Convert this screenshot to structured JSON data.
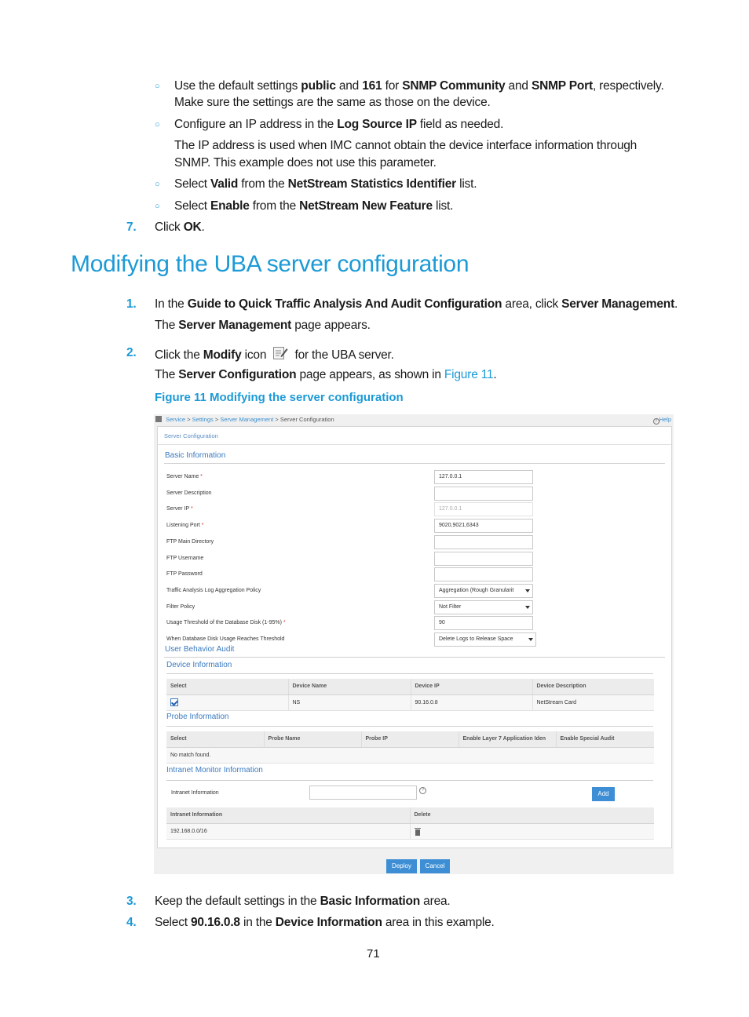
{
  "document": {
    "bullets_top": [
      {
        "parts": [
          [
            "Use the default settings ",
            false
          ],
          [
            "public",
            true
          ],
          [
            " and ",
            false
          ],
          [
            "161",
            true
          ],
          [
            " for ",
            false
          ],
          [
            "SNMP Community",
            true
          ],
          [
            " and ",
            false
          ],
          [
            "SNMP Port",
            true
          ],
          [
            ", respectively.",
            false
          ]
        ],
        "cont": "Make sure the settings are the same as those on the device."
      },
      {
        "parts": [
          [
            "Configure an IP address in the ",
            false
          ],
          [
            "Log Source IP",
            true
          ],
          [
            " field as needed.",
            false
          ]
        ]
      },
      {
        "para1": "The IP address is used when IMC cannot obtain the device interface information through",
        "para2": "SNMP. This example does not use this parameter."
      },
      {
        "parts": [
          [
            "Select ",
            false
          ],
          [
            "Valid",
            true
          ],
          [
            " from the ",
            false
          ],
          [
            "NetStream Statistics Identifier",
            true
          ],
          [
            " list.",
            false
          ]
        ]
      },
      {
        "parts": [
          [
            "Select ",
            false
          ],
          [
            "Enable",
            true
          ],
          [
            " from the ",
            false
          ],
          [
            "NetStream New Feature",
            true
          ],
          [
            " list.",
            false
          ]
        ]
      }
    ],
    "step7": {
      "num": "7.",
      "pre": "Click ",
      "bold": "OK",
      "post": "."
    },
    "heading": "Modifying the UBA server configuration",
    "step1": {
      "num": "1.",
      "a": "In the ",
      "b": "Guide to Quick Traffic Analysis And Audit Configuration",
      "c": " area, click ",
      "d": "Server Management",
      "e": ".",
      "sub_a": "The ",
      "sub_b": "Server Management",
      "sub_c": " page appears."
    },
    "step2": {
      "num": "2.",
      "a": "Click the ",
      "b": "Modify",
      "c": " icon",
      "d": " for the UBA server.",
      "sub_a": "The ",
      "sub_b": "Server Configuration",
      "sub_c": " page appears, as shown in ",
      "sub_link": "Figure 11",
      "sub_d": "."
    },
    "figure_caption": "Figure 11 Modifying the server configuration",
    "step3": {
      "num": "3.",
      "a": "Keep the default settings in the ",
      "b": "Basic Information",
      "c": " area."
    },
    "step4": {
      "num": "4.",
      "a": "Select ",
      "b": "90.16.0.8",
      "c": " in the ",
      "d": "Device Information",
      "e": " area in this example."
    },
    "page_number": "71"
  },
  "figure": {
    "breadcrumb": [
      "Service",
      "Settings",
      "Server Management",
      "Server Configuration"
    ],
    "help": "Help",
    "panel_title": "Server Configuration",
    "basic_info_title": "Basic Information",
    "fields": [
      {
        "label": "Server Name",
        "required": true,
        "value": "127.0.0.1",
        "type": "text"
      },
      {
        "label": "Server Description",
        "required": false,
        "value": "",
        "type": "text"
      },
      {
        "label": "Server IP",
        "required": true,
        "value": "127.0.0.1",
        "type": "disabled"
      },
      {
        "label": "Listening Port",
        "required": true,
        "value": "9020,9021,6343",
        "type": "text"
      },
      {
        "label": "FTP Main Directory",
        "required": false,
        "value": "",
        "type": "text"
      },
      {
        "label": "FTP Username",
        "required": false,
        "value": "",
        "type": "text"
      },
      {
        "label": "FTP Password",
        "required": false,
        "value": "",
        "type": "text"
      },
      {
        "label": "Traffic Analysis Log Aggregation Policy",
        "required": false,
        "value": "Aggregation (Rough Granularit",
        "type": "select"
      },
      {
        "label": "Filter Policy",
        "required": false,
        "value": "Not Filter",
        "type": "select"
      },
      {
        "label": "Usage Threshold of the Database Disk (1-95%)",
        "required": true,
        "value": "90",
        "type": "text"
      },
      {
        "label": "When Database Disk Usage Reaches Threshold",
        "required": false,
        "value": "Delete Logs to Release Space",
        "type": "select"
      }
    ],
    "uba_title": "User Behavior Audit",
    "device_info": {
      "title": "Device Information",
      "columns": [
        "Select",
        "Device Name",
        "Device IP",
        "Device Description"
      ],
      "rows": [
        {
          "checked": true,
          "name": "NS",
          "ip": "90.16.0.8",
          "description": "NetStream Card"
        }
      ]
    },
    "probe_info": {
      "title": "Probe Information",
      "columns": [
        "Select",
        "Probe Name",
        "Probe IP",
        "Enable Layer 7 Application Iden",
        "Enable Special Audit"
      ],
      "empty": "No match found."
    },
    "intranet": {
      "title": "Intranet Monitor Information",
      "label": "Intranet Information",
      "input_value": "",
      "add_label": "Add",
      "columns": [
        "Intranet Information",
        "Delete"
      ],
      "rows": [
        {
          "value": "192.168.0.0/16"
        }
      ]
    },
    "deploy_label": "Deploy",
    "cancel_label": "Cancel"
  },
  "colors": {
    "accent": "#1c9ad6",
    "button": "#3d8ed4",
    "section": "#3a7abf"
  }
}
